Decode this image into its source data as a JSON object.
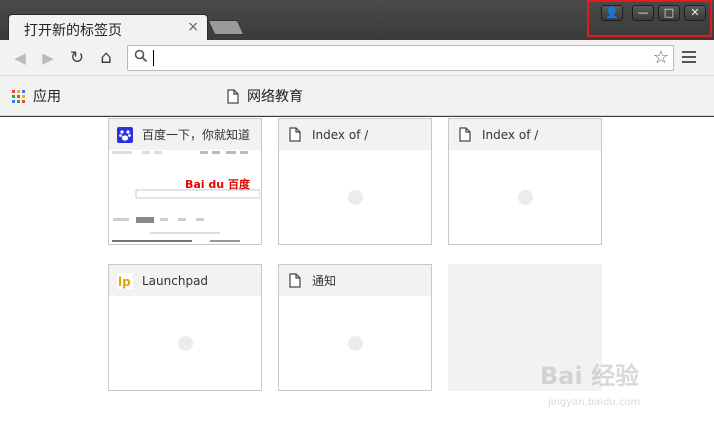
{
  "tab": {
    "title": "打开新的标签页",
    "close": "×"
  },
  "window_controls": {
    "profile": "👤",
    "minimize": "—",
    "maximize": "□",
    "close": "✕"
  },
  "toolbar": {
    "back": "◀",
    "forward": "▶",
    "reload": "↻",
    "home": "⌂",
    "star": "☆"
  },
  "omnibox": {
    "value": "",
    "placeholder": ""
  },
  "bookmarks": [
    {
      "label": "应用"
    },
    {
      "label": "网络教育"
    }
  ],
  "tiles": [
    {
      "title": "百度一下，你就知道",
      "icon": "baidu-paw-icon"
    },
    {
      "title": "Index of /",
      "icon": "document-icon"
    },
    {
      "title": "Index of /",
      "icon": "document-icon"
    },
    {
      "title": "Launchpad",
      "icon": "launchpad-icon"
    },
    {
      "title": "通知",
      "icon": "document-icon"
    }
  ],
  "thumbnail": {
    "logo": "Bai du 百度"
  },
  "watermark": {
    "brand": "Bai 经验",
    "url": "jingyan.baidu.com"
  },
  "colors": {
    "highlight": "#e31b1b",
    "baidu_blue": "#2932e1",
    "baidu_red": "#e10602"
  }
}
